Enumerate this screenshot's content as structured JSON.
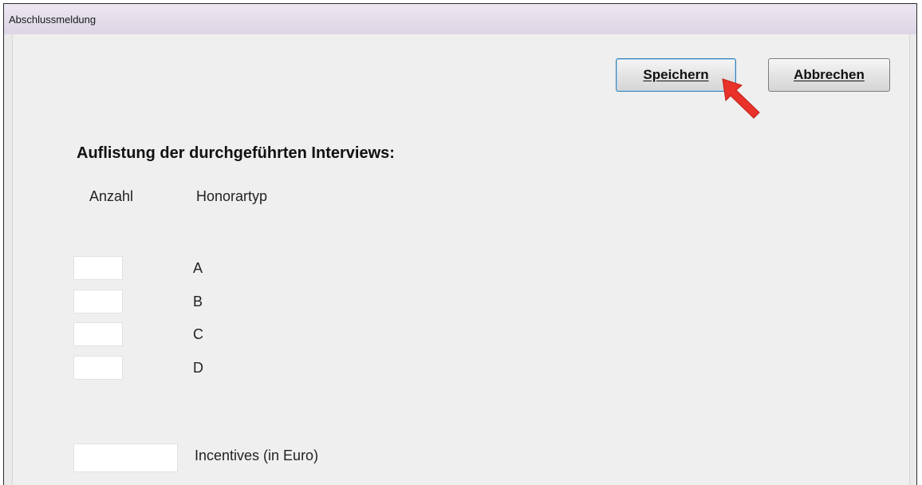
{
  "window": {
    "title": "Abschlussmeldung"
  },
  "toolbar": {
    "save_label": "Speichern",
    "cancel_label": "Abbrechen"
  },
  "form": {
    "heading": "Auflistung der durchgeführten Interviews:",
    "columns": {
      "count": "Anzahl",
      "fee_type": "Honorartyp"
    },
    "rows": [
      {
        "type": "A",
        "count": ""
      },
      {
        "type": "B",
        "count": ""
      },
      {
        "type": "C",
        "count": ""
      },
      {
        "type": "D",
        "count": ""
      }
    ],
    "incentives": {
      "label": "Incentives (in Euro)",
      "value": ""
    }
  },
  "annotation": {
    "icon": "red-arrow-icon",
    "color": "#e8322a"
  }
}
